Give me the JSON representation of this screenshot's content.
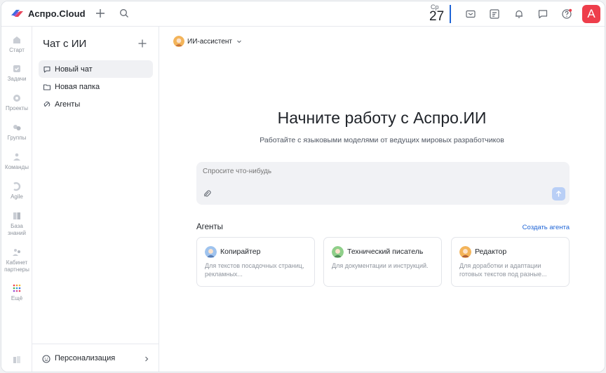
{
  "header": {
    "app_name": "Аспро.Cloud",
    "date_dow": "Ср",
    "date_day": "27",
    "user_initial": "A",
    "accent_color": "#1e64d6",
    "avatar_color": "#ee3e4b",
    "icons": [
      "add-icon",
      "search-icon",
      "mail-icon",
      "notes-icon",
      "bell-icon",
      "chat-icon",
      "help-icon"
    ]
  },
  "rail": {
    "items": [
      {
        "label": "Старт",
        "icon": "home-icon"
      },
      {
        "label": "Задачи",
        "icon": "tasks-icon"
      },
      {
        "label": "Проекты",
        "icon": "projects-icon"
      },
      {
        "label": "Группы",
        "icon": "groups-icon"
      },
      {
        "label": "Команды",
        "icon": "teams-icon"
      },
      {
        "label": "Agile",
        "icon": "agile-icon"
      },
      {
        "label": "База знаний",
        "icon": "knowledge-icon"
      },
      {
        "label": "Кабинет партнеры",
        "icon": "partner-icon"
      },
      {
        "label": "Ещё",
        "icon": "apps-grid-icon"
      }
    ]
  },
  "chatbar": {
    "title": "Чат с ИИ",
    "items": [
      {
        "label": "Новый чат",
        "icon": "new-chat-icon",
        "active": true
      },
      {
        "label": "Новая папка",
        "icon": "folder-add-icon",
        "active": false
      },
      {
        "label": "Агенты",
        "icon": "agents-icon",
        "active": false
      }
    ],
    "footer_label": "Персонализация"
  },
  "main": {
    "assistant_label": "ИИ-ассистент",
    "hero_title": "Начните работу с Аспро.ИИ",
    "hero_subtitle": "Работайте с языковыми моделями от ведущих мировых разработчиков",
    "prompt_placeholder": "Спросите что-нибудь",
    "agents_title": "Агенты",
    "agents_create": "Создать агента",
    "agents": [
      {
        "title": "Копирайтер",
        "description": "Для текстов посадочных страниц, рекламных..."
      },
      {
        "title": "Технический писатель",
        "description": "Для документации и инструкций."
      },
      {
        "title": "Редактор",
        "description": "Для доработки и адаптации готовых текстов под разные..."
      }
    ]
  }
}
